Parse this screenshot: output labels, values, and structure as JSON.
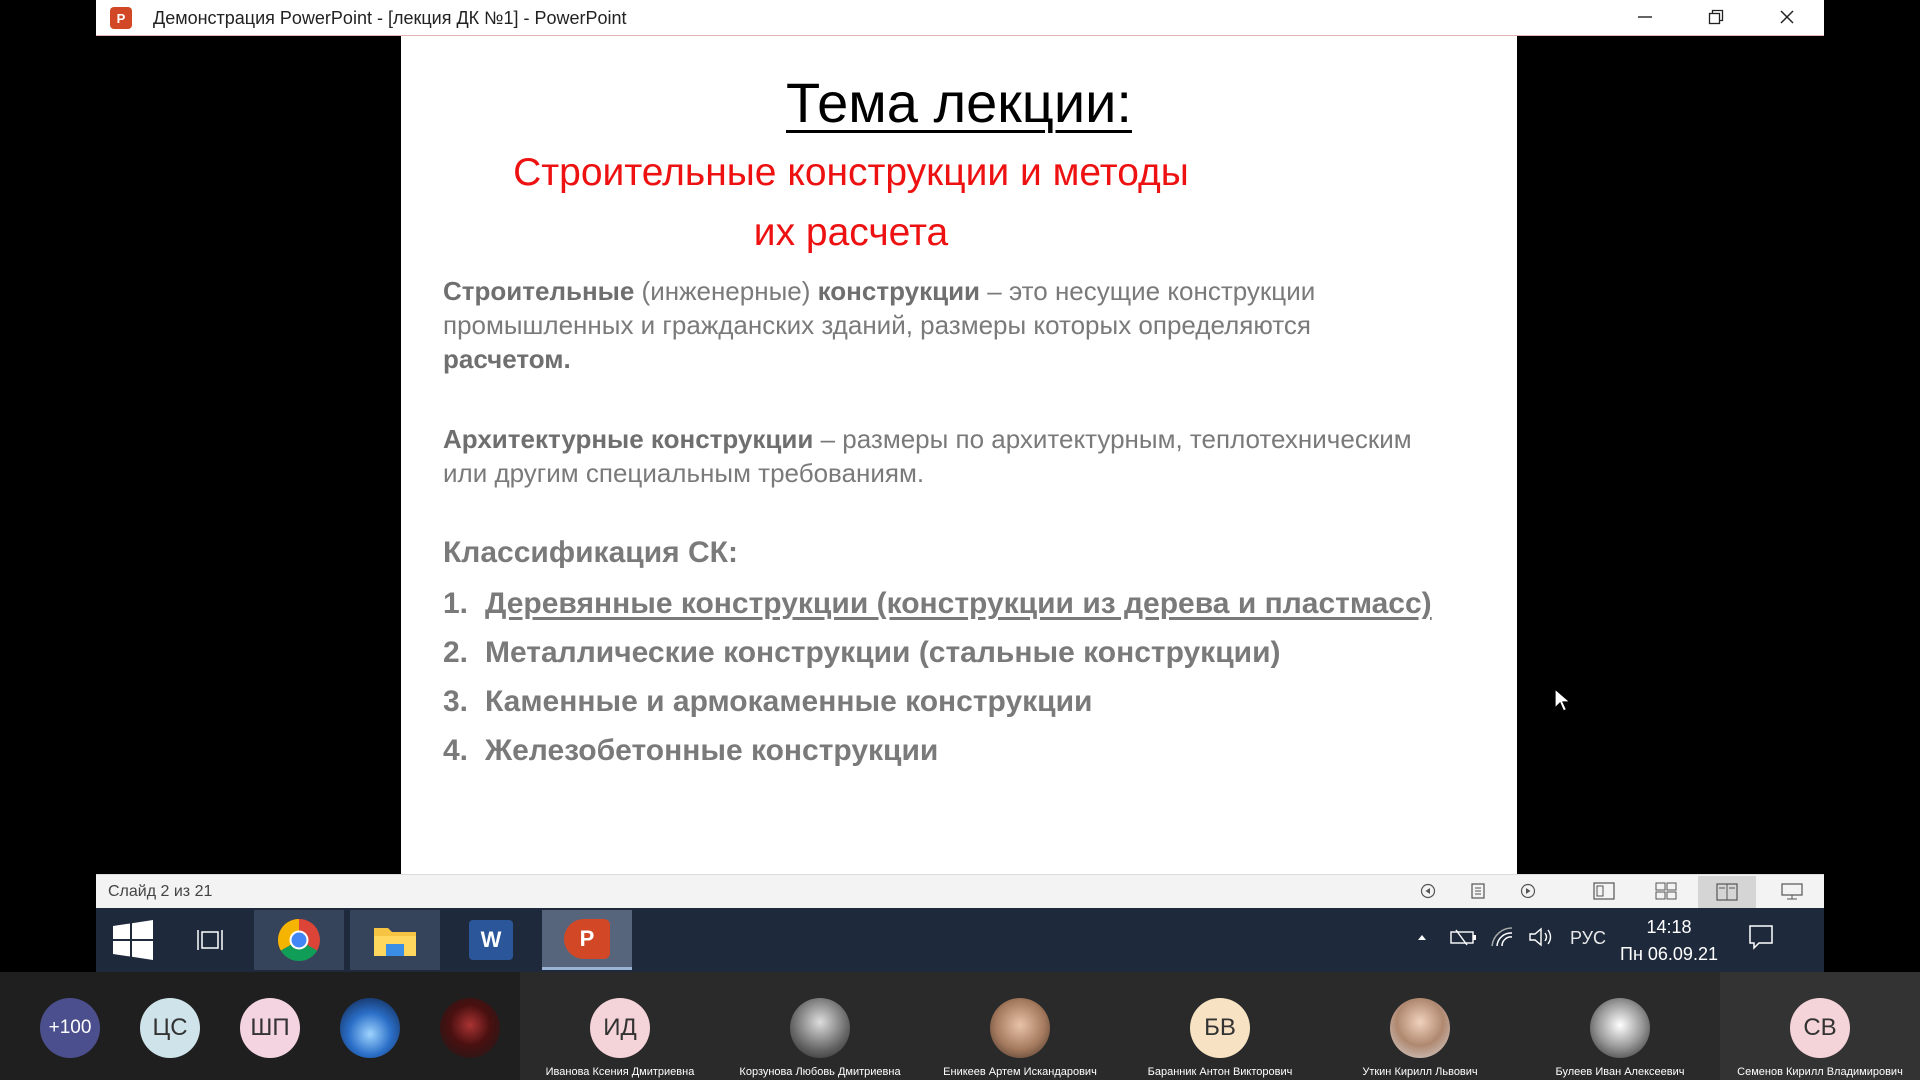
{
  "window": {
    "title": "Демонстрация PowerPoint - [лекция ДК №1] - PowerPoint",
    "app_icon": "P"
  },
  "slide": {
    "title": "Тема лекции:",
    "subtitle": "Строительные конструкции и методы их расчета",
    "para1": {
      "b1": "Строительные",
      "t1": " (инженерные) ",
      "b2": "конструкции",
      "t2": " – это несущие конструкции промышленных и гражданских зданий, размеры которых определяются ",
      "b3": "расчетом."
    },
    "para2": {
      "b1": "Архитектурные конструкции",
      "t1": " – размеры по  архитектурным, теплотехническим или другим специальным требованиям."
    },
    "classification_heading": "Классификация СК:",
    "list": [
      {
        "num": "1.",
        "text": "Деревянные конструкции (конструкции из дерева и пластмасс)"
      },
      {
        "num": "2.",
        "text": "Металлические конструкции (стальные конструкции)"
      },
      {
        "num": "3.",
        "text": "Каменные и армокаменные конструкции"
      },
      {
        "num": "4.",
        "text": "Железобетонные конструкции"
      }
    ]
  },
  "statusbar": {
    "slide_count": "Слайд 2 из 21"
  },
  "taskbar": {
    "word_label": "W",
    "ppt_label": "P",
    "lang": "РУС",
    "time": "14:18",
    "date": "Пн 06.09.21"
  },
  "participants": {
    "more": "+100",
    "small": [
      {
        "initials": "ЦС",
        "bg": "#cfe3ea",
        "fg": "#333"
      },
      {
        "initials": "ШП",
        "bg": "#f4d4e0",
        "fg": "#333"
      }
    ],
    "tiles": [
      {
        "initials": "ИД",
        "name": "Иванова Ксения Дмитриевна"
      },
      {
        "initials": "",
        "name": "Корзунова Любовь Дмитриевна"
      },
      {
        "initials": "",
        "name": "Еникеев Артем Искандарович"
      },
      {
        "initials": "БВ",
        "name": "Баранник Антон Викторович"
      },
      {
        "initials": "",
        "name": "Уткин Кирилл Львович"
      },
      {
        "initials": "",
        "name": "Булеев Иван Алексеевич"
      },
      {
        "initials": "СВ",
        "name": "Семенов Кирилл Владимирович"
      }
    ]
  },
  "colors": {
    "subtitle": "#ee1111",
    "body_text": "#7a7a7a",
    "taskbar": "#1e2a3c",
    "strip": "#1f1f1f"
  }
}
